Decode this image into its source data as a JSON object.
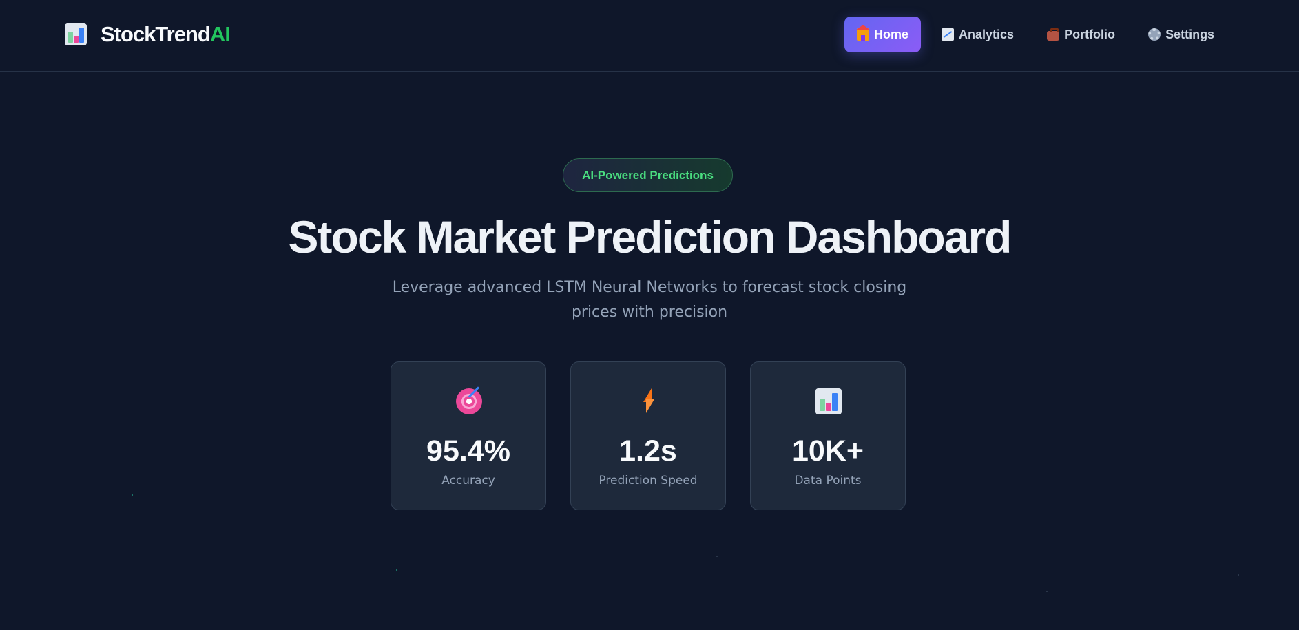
{
  "header": {
    "brand_main": "StockTrend",
    "brand_accent": "AI",
    "brand_icon": "bar-chart-icon",
    "nav": [
      {
        "label": "Home",
        "icon": "house-icon",
        "active": true
      },
      {
        "label": "Analytics",
        "icon": "chart-increasing-icon",
        "active": false
      },
      {
        "label": "Portfolio",
        "icon": "briefcase-icon",
        "active": false
      },
      {
        "label": "Settings",
        "icon": "gear-icon",
        "active": false
      }
    ]
  },
  "hero": {
    "badge": "AI-Powered Predictions",
    "title": "Stock Market Prediction Dashboard",
    "subtitle": "Leverage advanced LSTM Neural Networks to forecast stock closing prices with precision"
  },
  "stats": [
    {
      "icon": "target-icon",
      "value": "95.4%",
      "label": "Accuracy"
    },
    {
      "icon": "lightning-icon",
      "value": "1.2s",
      "label": "Prediction Speed"
    },
    {
      "icon": "bar-chart-icon",
      "value": "10K+",
      "label": "Data Points"
    }
  ],
  "colors": {
    "background": "#0f172a",
    "card": "#1e293b",
    "accent_green": "#22c55e",
    "accent_purple": "#6366f1",
    "muted_text": "#94a3b8"
  }
}
